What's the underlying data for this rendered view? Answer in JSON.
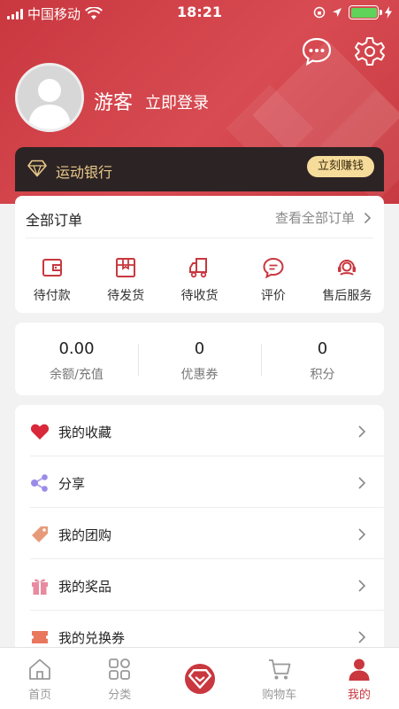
{
  "status_bar": {
    "carrier": "中国移动",
    "time": "18:21"
  },
  "profile": {
    "name": "游客",
    "login_label": "立即登录"
  },
  "bank": {
    "label": "运动银行",
    "earn_button": "立刻赚钱"
  },
  "orders": {
    "title": "全部订单",
    "view_all": "查看全部订单",
    "items": [
      {
        "label": "待付款",
        "icon": "wallet-icon"
      },
      {
        "label": "待发货",
        "icon": "box-icon"
      },
      {
        "label": "待收货",
        "icon": "truck-icon"
      },
      {
        "label": "评价",
        "icon": "comment-icon"
      },
      {
        "label": "售后服务",
        "icon": "service-icon"
      }
    ]
  },
  "stats": [
    {
      "value": "0.00",
      "label": "余额/充值"
    },
    {
      "value": "0",
      "label": "优惠券"
    },
    {
      "value": "0",
      "label": "积分"
    }
  ],
  "menu": [
    {
      "label": "我的收藏",
      "icon": "heart-icon",
      "color": "#d9283a"
    },
    {
      "label": "分享",
      "icon": "share-icon",
      "color": "#9b8be8"
    },
    {
      "label": "我的团购",
      "icon": "tag-icon",
      "color": "#e79a7a"
    },
    {
      "label": "我的奖品",
      "icon": "gift-icon",
      "color": "#e88aa0"
    },
    {
      "label": "我的兑换券",
      "icon": "coupon-icon",
      "color": "#e8775e"
    }
  ],
  "tabbar": [
    {
      "label": "首页",
      "icon": "home-icon"
    },
    {
      "label": "分类",
      "icon": "grid-icon"
    },
    {
      "label": "",
      "icon": "diamond-icon"
    },
    {
      "label": "购物车",
      "icon": "cart-icon"
    },
    {
      "label": "我的",
      "icon": "user-icon",
      "active": true
    }
  ],
  "colors": {
    "brand": "#c9373f",
    "bank_bg": "#2c2324",
    "gold": "#e9c98a"
  }
}
